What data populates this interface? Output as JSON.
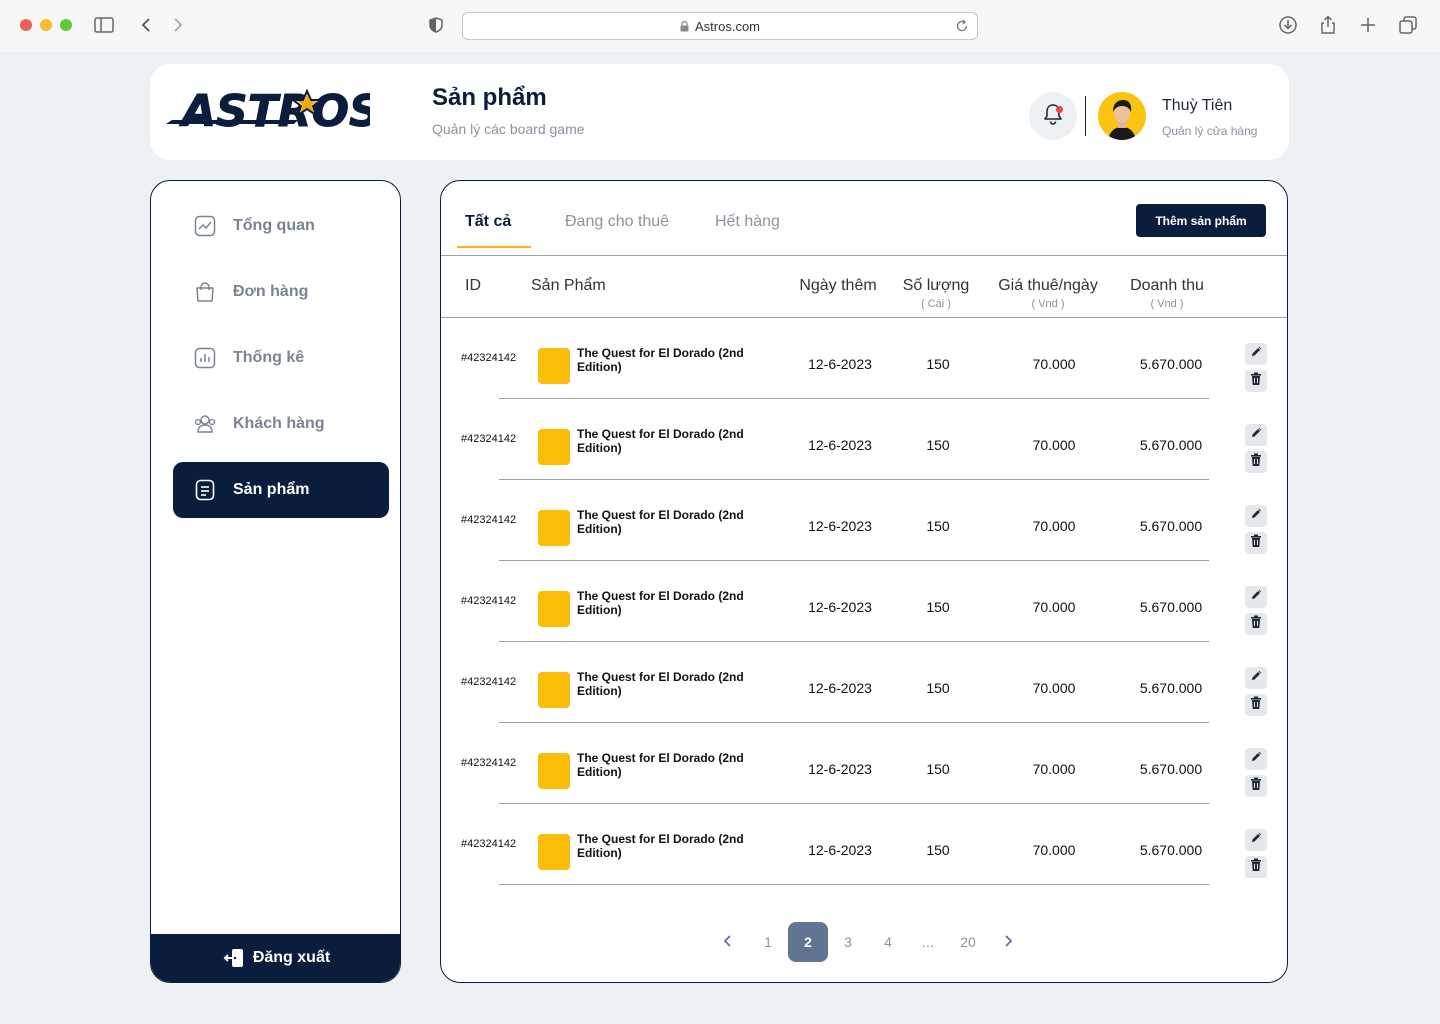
{
  "browser": {
    "url": "Astros.com"
  },
  "header": {
    "logo_text": "ASTROS",
    "title": "Sản phẩm",
    "subtitle": "Quản lý các board game",
    "user_name": "Thuỳ Tiên",
    "user_role": "Quản lý cửa hàng"
  },
  "sidebar": {
    "items": [
      {
        "label": "Tổng quan",
        "icon": "chart-icon",
        "active": false
      },
      {
        "label": "Đơn hàng",
        "icon": "bag-icon",
        "active": false
      },
      {
        "label": "Thống kê",
        "icon": "stats-icon",
        "active": false
      },
      {
        "label": "Khách hàng",
        "icon": "users-icon",
        "active": false
      },
      {
        "label": "Sản phẩm",
        "icon": "document-icon",
        "active": true
      }
    ],
    "logout_label": "Đăng xuất"
  },
  "tabs": [
    {
      "label": "Tất cả",
      "active": true
    },
    {
      "label": "Đang cho thuê",
      "active": false
    },
    {
      "label": "Hết hàng",
      "active": false
    }
  ],
  "add_button": "Thêm sản phẩm",
  "table": {
    "headers": {
      "id": "ID",
      "product": "Sản Phẩm",
      "date": "Ngày thêm",
      "qty": "Số lượng",
      "qty_unit": "( Cái )",
      "price": "Giá thuê/ngày",
      "price_unit": "( Vnd )",
      "revenue": "Doanh thu",
      "revenue_unit": "( Vnd )"
    },
    "rows": [
      {
        "id": "#42324142",
        "name": "The Quest for El Dorado (2nd Edition)",
        "date": "12-6-2023",
        "qty": "150",
        "price": "70.000",
        "revenue": "5.670.000"
      },
      {
        "id": "#42324142",
        "name": "The Quest for El Dorado (2nd Edition)",
        "date": "12-6-2023",
        "qty": "150",
        "price": "70.000",
        "revenue": "5.670.000"
      },
      {
        "id": "#42324142",
        "name": "The Quest for El Dorado (2nd Edition)",
        "date": "12-6-2023",
        "qty": "150",
        "price": "70.000",
        "revenue": "5.670.000"
      },
      {
        "id": "#42324142",
        "name": "The Quest for El Dorado (2nd Edition)",
        "date": "12-6-2023",
        "qty": "150",
        "price": "70.000",
        "revenue": "5.670.000"
      },
      {
        "id": "#42324142",
        "name": "The Quest for El Dorado (2nd Edition)",
        "date": "12-6-2023",
        "qty": "150",
        "price": "70.000",
        "revenue": "5.670.000"
      },
      {
        "id": "#42324142",
        "name": "The Quest for El Dorado (2nd Edition)",
        "date": "12-6-2023",
        "qty": "150",
        "price": "70.000",
        "revenue": "5.670.000"
      },
      {
        "id": "#42324142",
        "name": "The Quest for El Dorado (2nd Edition)",
        "date": "12-6-2023",
        "qty": "150",
        "price": "70.000",
        "revenue": "5.670.000"
      }
    ]
  },
  "pagination": {
    "pages": [
      "1",
      "2",
      "3",
      "4",
      "...",
      "20"
    ],
    "current": "2"
  },
  "colors": {
    "primary": "#0b1d3d",
    "accent": "#f9b90a",
    "thumb": "#fbbd08",
    "page_active": "#5f7591"
  }
}
